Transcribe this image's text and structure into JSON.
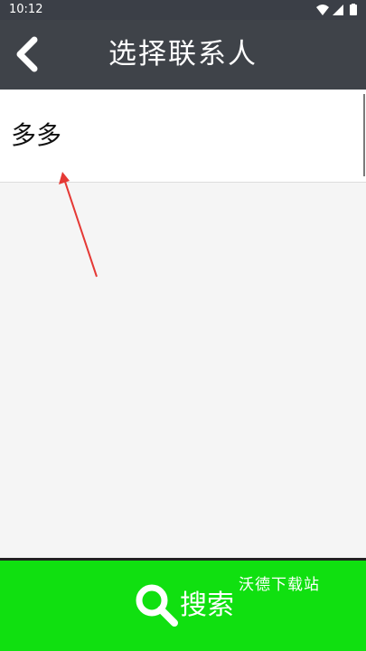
{
  "status_bar": {
    "time": "10:12"
  },
  "header": {
    "title": "选择联系人"
  },
  "contacts": [
    {
      "name": "多多"
    }
  ],
  "search_button": {
    "label": "搜索"
  },
  "watermark": {
    "text": "沃德下载站"
  },
  "colors": {
    "header_bg": "#3f4349",
    "status_bar_bg": "#3b3f47",
    "search_button_bg": "#10e010",
    "annotation_arrow": "#e53935"
  },
  "icons": [
    "wifi-icon",
    "signal-icon",
    "battery-icon",
    "back-arrow-icon",
    "search-icon"
  ]
}
